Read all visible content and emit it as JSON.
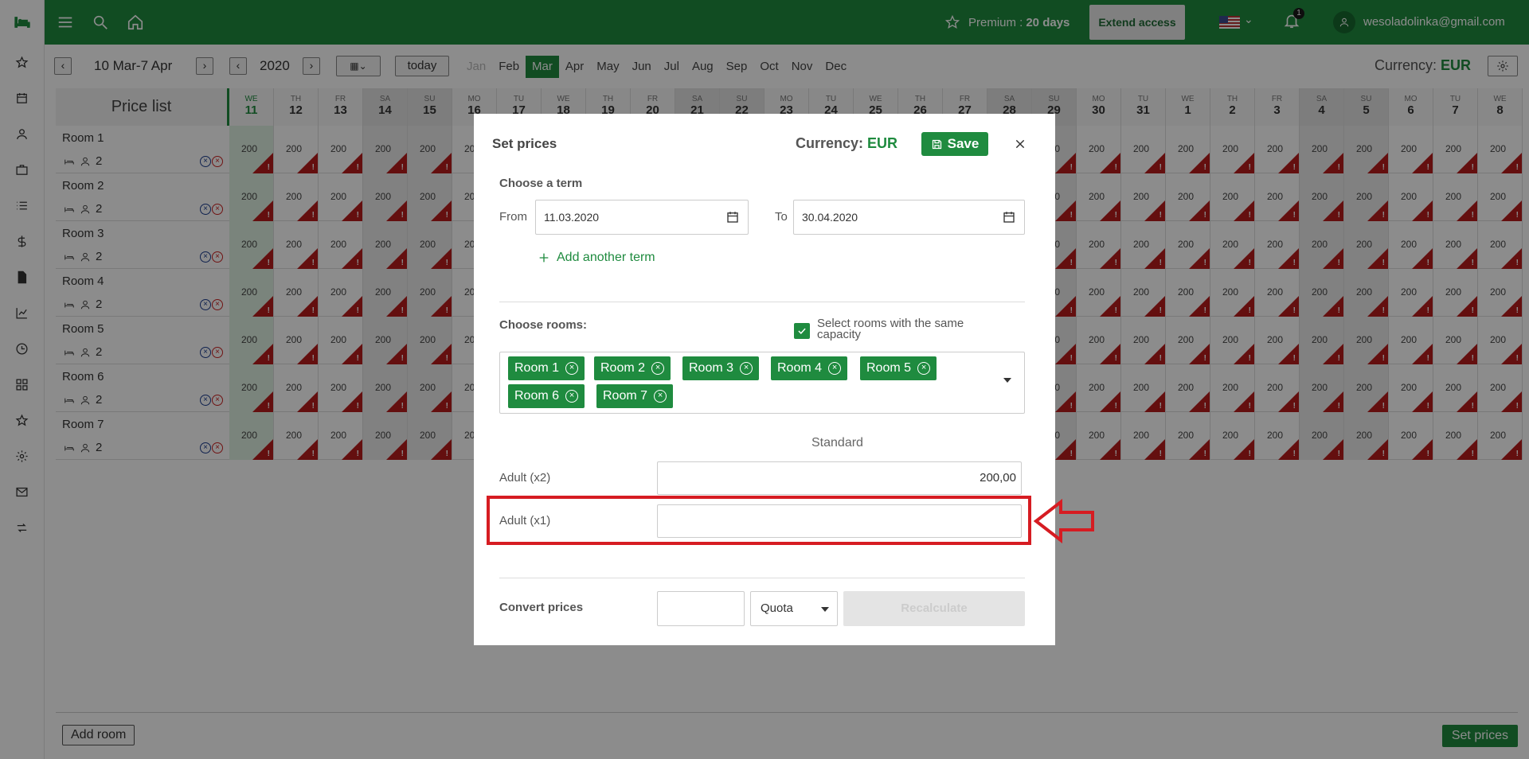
{
  "topbar": {
    "premium_label": "Premium :",
    "premium_days": "20 days",
    "extend_label": "Extend access",
    "notifications_count": "1",
    "user_email": "wesoladolinka@gmail.com"
  },
  "toolbar": {
    "prev_label": "‹",
    "next_label": "›",
    "date_range": "10 Mar-7 Apr",
    "year": "2020",
    "calendar_label": "▦⌄",
    "today_label": "today",
    "months": [
      "Jan",
      "Feb",
      "Mar",
      "Apr",
      "May",
      "Jun",
      "Jul",
      "Aug",
      "Sep",
      "Oct",
      "Nov",
      "Dec"
    ],
    "active_month": "Mar",
    "currency_label": "Currency:",
    "currency_value": "EUR"
  },
  "grid": {
    "title": "Price list",
    "days": [
      {
        "name": "WE",
        "num": "11"
      },
      {
        "name": "TH",
        "num": "12"
      },
      {
        "name": "FR",
        "num": "13"
      },
      {
        "name": "SA",
        "num": "14"
      },
      {
        "name": "SU",
        "num": "15"
      },
      {
        "name": "MO",
        "num": "16"
      },
      {
        "name": "TU",
        "num": "17"
      },
      {
        "name": "WE",
        "num": "18"
      },
      {
        "name": "TH",
        "num": "19"
      },
      {
        "name": "FR",
        "num": "20"
      },
      {
        "name": "SA",
        "num": "21"
      },
      {
        "name": "SU",
        "num": "22"
      },
      {
        "name": "MO",
        "num": "23"
      },
      {
        "name": "TU",
        "num": "24"
      },
      {
        "name": "WE",
        "num": "25"
      },
      {
        "name": "TH",
        "num": "26"
      },
      {
        "name": "FR",
        "num": "27"
      },
      {
        "name": "SA",
        "num": "28"
      },
      {
        "name": "SU",
        "num": "29"
      },
      {
        "name": "MO",
        "num": "30"
      },
      {
        "name": "TU",
        "num": "31"
      },
      {
        "name": "WE",
        "num": "1"
      },
      {
        "name": "TH",
        "num": "2"
      },
      {
        "name": "FR",
        "num": "3"
      },
      {
        "name": "SA",
        "num": "4"
      },
      {
        "name": "SU",
        "num": "5"
      },
      {
        "name": "MO",
        "num": "6"
      },
      {
        "name": "TU",
        "num": "7"
      },
      {
        "name": "WE",
        "num": "8"
      }
    ],
    "rooms": [
      {
        "name": "Room 1",
        "capacity": "2"
      },
      {
        "name": "Room 2",
        "capacity": "2"
      },
      {
        "name": "Room 3",
        "capacity": "2"
      },
      {
        "name": "Room 4",
        "capacity": "2"
      },
      {
        "name": "Room 5",
        "capacity": "2"
      },
      {
        "name": "Room 6",
        "capacity": "2"
      },
      {
        "name": "Room 7",
        "capacity": "2"
      }
    ],
    "cell_price": "200"
  },
  "bottombar": {
    "add_room_label": "Add room",
    "set_prices_label": "Set prices"
  },
  "modal": {
    "title": "Set prices",
    "currency_label": "Currency:",
    "currency_value": "EUR",
    "save_label": "Save",
    "choose_term_label": "Choose a term",
    "from_label": "From",
    "from_value": "11.03.2020",
    "to_label": "To",
    "to_value": "30.04.2020",
    "add_term_label": "Add another term",
    "choose_rooms_label": "Choose rooms:",
    "same_capacity_label": "Select rooms with the same capacity",
    "selected_rooms": [
      "Room 1",
      "Room 2",
      "Room 3",
      "Room 4",
      "Room 5",
      "Room 6",
      "Room 7"
    ],
    "column_header": "Standard",
    "adult_x2_label": "Adult (x2)",
    "adult_x2_value": "200,00",
    "adult_x1_label": "Adult (x1)",
    "adult_x1_value": "",
    "convert_label": "Convert prices",
    "quota_value": "Quota",
    "recalculate_label": "Recalculate"
  },
  "colors": {
    "brand_green": "#1f8b3f",
    "annotation_red": "#d61c22",
    "price_triangle": "#b71c1c"
  }
}
